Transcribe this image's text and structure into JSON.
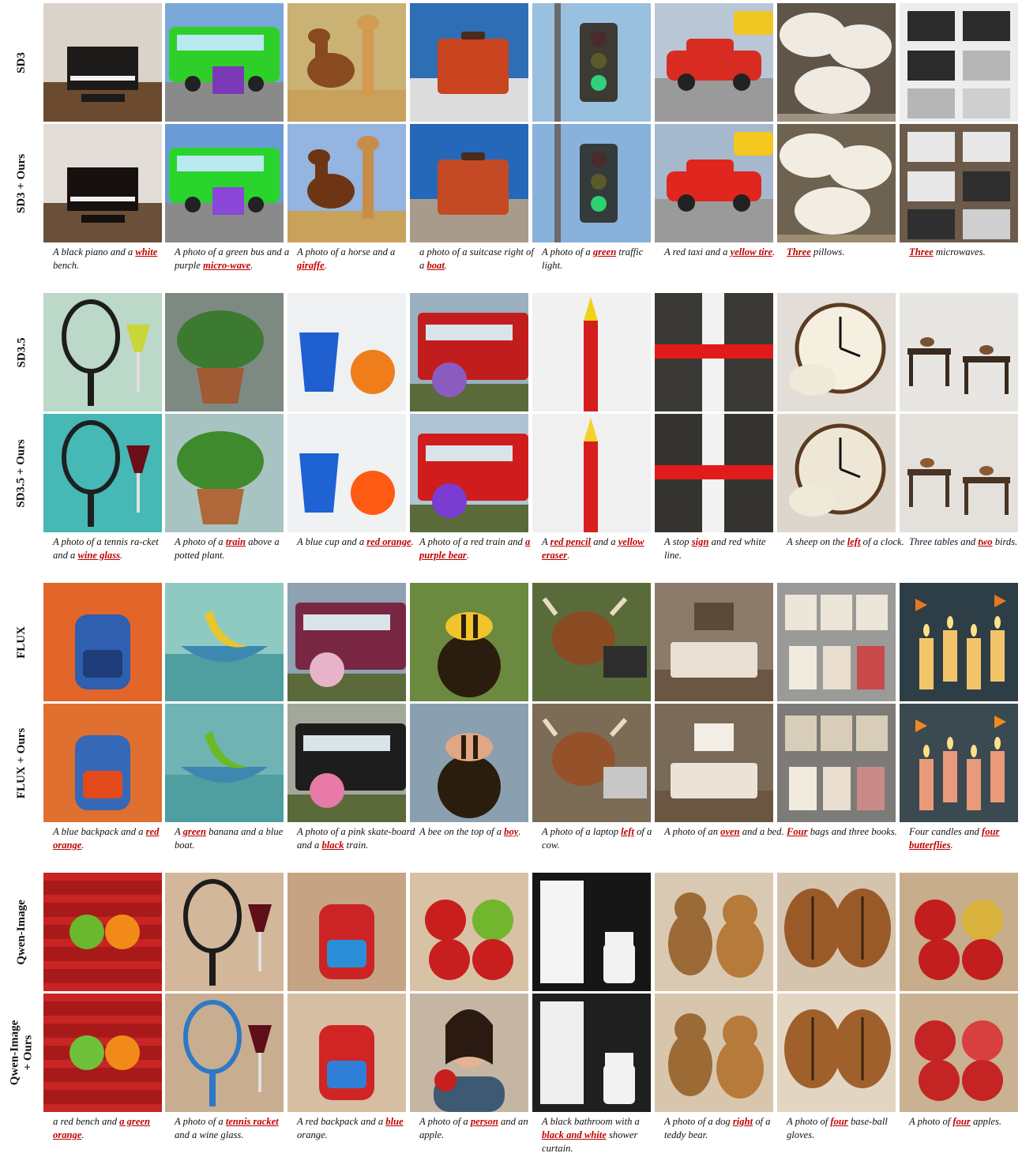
{
  "groups": [
    {
      "rows": [
        "SD3",
        "SD3 + Ours"
      ],
      "tiles": [
        [
          {
            "name": "piano-image",
            "bg": "#d9d3c9",
            "fg": "#1c1b1a",
            "accent": "#6b4a2f",
            "shape": "piano"
          },
          {
            "name": "piano-image",
            "bg": "#e2ddd6",
            "fg": "#16110e",
            "accent": "#6a4f39",
            "shape": "piano"
          }
        ],
        [
          {
            "name": "bus-image",
            "bg": "#7aa8d8",
            "fg": "#2fcf2a",
            "accent": "#7b39b8",
            "shape": "bus"
          },
          {
            "name": "bus-image",
            "bg": "#6b9bd6",
            "fg": "#29d42c",
            "accent": "#8a47d8",
            "shape": "bus"
          }
        ],
        [
          {
            "name": "horse-giraffe-image",
            "bg": "#c9b274",
            "fg": "#8a4a1f",
            "accent": "#d49a52",
            "shape": "animal"
          },
          {
            "name": "horse-giraffe-image",
            "bg": "#93b5df",
            "fg": "#6e3514",
            "accent": "#c98d4a",
            "shape": "animal"
          }
        ],
        [
          {
            "name": "suitcase-image",
            "bg": "#2d6eb5",
            "fg": "#c9441f",
            "accent": "#dcdcdc",
            "shape": "box"
          },
          {
            "name": "suitcase-image",
            "bg": "#2568b9",
            "fg": "#c34a25",
            "accent": "#a99b8c",
            "shape": "box"
          }
        ],
        [
          {
            "name": "traffic-light-image",
            "bg": "#9ac0e0",
            "fg": "#3d3a33",
            "accent": "#2fd17f",
            "shape": "light"
          },
          {
            "name": "traffic-light-image",
            "bg": "#88b2db",
            "fg": "#353a3a",
            "accent": "#2fd06e",
            "shape": "light"
          }
        ],
        [
          {
            "name": "taxi-image",
            "bg": "#b9c6d5",
            "fg": "#d82c23",
            "accent": "#f0c622",
            "shape": "car"
          },
          {
            "name": "taxi-image",
            "bg": "#a6b8cc",
            "fg": "#e0271f",
            "accent": "#f4c81e",
            "shape": "car"
          }
        ],
        [
          {
            "name": "pillows-image",
            "bg": "#5f5548",
            "fg": "#efebe2",
            "accent": "#9d927f",
            "shape": "pillows"
          },
          {
            "name": "pillows-image",
            "bg": "#6e6250",
            "fg": "#f2ede3",
            "accent": "#9b8c72",
            "shape": "pillows"
          }
        ],
        [
          {
            "name": "microwaves-image",
            "bg": "#ededed",
            "fg": "#2b2b2b",
            "accent": "#b6b6b6",
            "shape": "microwaves"
          },
          {
            "name": "microwaves-image",
            "bg": "#6c5b4b",
            "fg": "#e8e8e8",
            "accent": "#2f2f2f",
            "shape": "microwaves"
          }
        ]
      ],
      "captions": [
        [
          {
            "t": "A black piano and a "
          },
          {
            "t": "white",
            "h": true
          },
          {
            "t": " bench."
          }
        ],
        [
          {
            "t": "A photo of a green bus and a purple "
          },
          {
            "t": "micro-wave",
            "h": true
          },
          {
            "t": "."
          }
        ],
        [
          {
            "t": "A photo of a horse and a "
          },
          {
            "t": "giraffe",
            "h": true
          },
          {
            "t": "."
          }
        ],
        [
          {
            "t": "a photo of a suitcase right of a "
          },
          {
            "t": "boat",
            "h": true
          },
          {
            "t": "."
          }
        ],
        [
          {
            "t": "A photo of a "
          },
          {
            "t": "green",
            "h": true
          },
          {
            "t": " traffic light."
          }
        ],
        [
          {
            "t": "A red taxi and a "
          },
          {
            "t": "yellow tire",
            "h": true
          },
          {
            "t": "."
          }
        ],
        [
          {
            "t": "Three",
            "h": true
          },
          {
            "t": " pillows."
          }
        ],
        [
          {
            "t": "Three",
            "h": true
          },
          {
            "t": " microwaves."
          }
        ]
      ]
    },
    {
      "rows": [
        "SD3.5",
        "SD3.5 + Ours"
      ],
      "tiles": [
        [
          {
            "name": "tennis-racket-image",
            "bg": "#bcd8c8",
            "fg": "#1d1d1d",
            "accent": "#c9d63a",
            "shape": "racket"
          },
          {
            "name": "tennis-racket-image",
            "bg": "#46b8b6",
            "fg": "#1f1f1f",
            "accent": "#6a0e1a",
            "shape": "racket"
          }
        ],
        [
          {
            "name": "potted-plant-image",
            "bg": "#7d8a82",
            "fg": "#3d7a31",
            "accent": "#a05a34",
            "shape": "plant"
          },
          {
            "name": "potted-plant-image",
            "bg": "#a8c4c2",
            "fg": "#3f8a2c",
            "accent": "#b0683a",
            "shape": "plant"
          }
        ],
        [
          {
            "name": "cup-orange-image",
            "bg": "#eef0f2",
            "fg": "#1f5fd0",
            "accent": "#ef7d1a",
            "shape": "cup"
          },
          {
            "name": "cup-orange-image",
            "bg": "#f0f1f3",
            "fg": "#1e62d4",
            "accent": "#ff5a12",
            "shape": "cup"
          }
        ],
        [
          {
            "name": "train-bear-image",
            "bg": "#9ab0c0",
            "fg": "#c21d1d",
            "accent": "#8a5cc0",
            "shape": "train"
          },
          {
            "name": "train-bear-image",
            "bg": "#aec4d4",
            "fg": "#d01c1c",
            "accent": "#7a3cd1",
            "shape": "train"
          }
        ],
        [
          {
            "name": "pencil-image",
            "bg": "#f1f1f1",
            "fg": "#d61d1d",
            "accent": "#f0d21a",
            "shape": "pencil"
          },
          {
            "name": "pencil-image",
            "bg": "#f0f0f0",
            "fg": "#d81e1e",
            "accent": "#f2d32c",
            "shape": "pencil"
          }
        ],
        [
          {
            "name": "road-line-image",
            "bg": "#3b3935",
            "fg": "#f2f2f2",
            "accent": "#e11a1a",
            "shape": "road"
          },
          {
            "name": "road-line-image",
            "bg": "#363431",
            "fg": "#f3f3f3",
            "accent": "#e21c1c",
            "shape": "road"
          }
        ],
        [
          {
            "name": "clock-sheep-image",
            "bg": "#e2ddd6",
            "fg": "#f5efe0",
            "accent": "#5b3b22",
            "shape": "clock"
          },
          {
            "name": "clock-sheep-image",
            "bg": "#ddd6cc",
            "fg": "#efe7d6",
            "accent": "#5a3a20",
            "shape": "clock"
          }
        ],
        [
          {
            "name": "tables-birds-image",
            "bg": "#e8e6e3",
            "fg": "#3a2a1e",
            "accent": "#7a5230",
            "shape": "tables"
          },
          {
            "name": "tables-birds-image",
            "bg": "#e4e1dc",
            "fg": "#4a3424",
            "accent": "#8b5c34",
            "shape": "tables"
          }
        ]
      ],
      "captions": [
        [
          {
            "t": "A photo of a tennis ra-cket and a "
          },
          {
            "t": "wine glass",
            "h": true
          },
          {
            "t": "."
          }
        ],
        [
          {
            "t": "A photo of a "
          },
          {
            "t": "train",
            "h": true
          },
          {
            "t": " above a potted plant."
          }
        ],
        [
          {
            "t": "A blue cup and a "
          },
          {
            "t": "red orange",
            "h": true
          },
          {
            "t": "."
          }
        ],
        [
          {
            "t": "A photo of a red train and "
          },
          {
            "t": "a purple bear",
            "h": true
          },
          {
            "t": "."
          }
        ],
        [
          {
            "t": "A "
          },
          {
            "t": "red pencil",
            "h": true
          },
          {
            "t": " and a "
          },
          {
            "t": "yellow eraser",
            "h": true
          },
          {
            "t": "."
          }
        ],
        [
          {
            "t": "A stop "
          },
          {
            "t": "sign",
            "h": true
          },
          {
            "t": " and red white line."
          }
        ],
        [
          {
            "t": "A sheep on the "
          },
          {
            "t": "left",
            "h": true
          },
          {
            "t": " of a clock."
          }
        ],
        [
          {
            "t": "Three tables and "
          },
          {
            "t": "two",
            "h": true
          },
          {
            "t": " birds."
          }
        ]
      ]
    },
    {
      "rows": [
        "FLUX",
        "FLUX + Ours"
      ],
      "tiles": [
        [
          {
            "name": "backpack-image",
            "bg": "#e2652a",
            "fg": "#2f5fae",
            "accent": "#1d3c78",
            "shape": "backpack"
          },
          {
            "name": "backpack-image",
            "bg": "#e0702f",
            "fg": "#3668b8",
            "accent": "#e24a1c",
            "shape": "backpack"
          }
        ],
        [
          {
            "name": "banana-boat-image",
            "bg": "#8fcac2",
            "fg": "#e9c62c",
            "accent": "#4fa0a8",
            "shape": "banana"
          },
          {
            "name": "banana-boat-image",
            "bg": "#6fb3b3",
            "fg": "#6cb828",
            "accent": "#3c8fa3",
            "shape": "banana"
          }
        ],
        [
          {
            "name": "train-skateboard-image",
            "bg": "#8ea2b3",
            "fg": "#7a2743",
            "accent": "#e6b3c8",
            "shape": "train"
          },
          {
            "name": "train-skateboard-image",
            "bg": "#a4a89b",
            "fg": "#1d1d1d",
            "accent": "#e87aa8",
            "shape": "train"
          }
        ],
        [
          {
            "name": "bee-image",
            "bg": "#6b8a3f",
            "fg": "#f0c42a",
            "accent": "#2b1d0e",
            "shape": "bee"
          },
          {
            "name": "bee-image",
            "bg": "#8aa0b0",
            "fg": "#e0a783",
            "accent": "#2b1d0e",
            "shape": "bee"
          }
        ],
        [
          {
            "name": "cow-laptop-image",
            "bg": "#5a6b3a",
            "fg": "#8a4a22",
            "accent": "#2d2d2d",
            "shape": "cow"
          },
          {
            "name": "cow-laptop-image",
            "bg": "#7c6b55",
            "fg": "#94512a",
            "accent": "#c7c7c7",
            "shape": "cow"
          }
        ],
        [
          {
            "name": "bedroom-image",
            "bg": "#8c7b68",
            "fg": "#e9e0d3",
            "accent": "#5b4a3a",
            "shape": "bed"
          },
          {
            "name": "bedroom-image",
            "bg": "#7a6a58",
            "fg": "#ece3d6",
            "accent": "#f2ede5",
            "shape": "bed"
          }
        ],
        [
          {
            "name": "bags-books-image",
            "bg": "#9a9a98",
            "fg": "#ece6d8",
            "accent": "#c84a4a",
            "shape": "bags"
          },
          {
            "name": "bags-books-image",
            "bg": "#7d7b78",
            "fg": "#d8cdb8",
            "accent": "#c98a8a",
            "shape": "bags"
          }
        ],
        [
          {
            "name": "candles-butterflies-image",
            "bg": "#2e3e46",
            "fg": "#f3c56a",
            "accent": "#e5781f",
            "shape": "candles"
          },
          {
            "name": "candles-butterflies-image",
            "bg": "#3a4a50",
            "fg": "#e89a7a",
            "accent": "#ee8a1f",
            "shape": "candles"
          }
        ]
      ],
      "captions": [
        [
          {
            "t": "A blue backpack and a "
          },
          {
            "t": "red orange",
            "h": true
          },
          {
            "t": "."
          }
        ],
        [
          {
            "t": "A "
          },
          {
            "t": "green",
            "h": true
          },
          {
            "t": " banana and a blue boat."
          }
        ],
        [
          {
            "t": "A photo of a pink skate-board and a "
          },
          {
            "t": "black",
            "h": true
          },
          {
            "t": " train."
          }
        ],
        [
          {
            "t": "A bee on the top of a "
          },
          {
            "t": "boy",
            "h": true
          },
          {
            "t": "."
          }
        ],
        [
          {
            "t": "A photo of a laptop "
          },
          {
            "t": "left",
            "h": true
          },
          {
            "t": " of a cow."
          }
        ],
        [
          {
            "t": "A photo of an "
          },
          {
            "t": "oven",
            "h": true
          },
          {
            "t": " and a bed."
          }
        ],
        [
          {
            "t": "Four",
            "h": true
          },
          {
            "t": " bags and three books."
          }
        ],
        [
          {
            "t": "Four candles and "
          },
          {
            "t": "four butterflies",
            "h": true
          },
          {
            "t": "."
          }
        ]
      ]
    },
    {
      "rows": [
        "Qwen-Image",
        "Qwen-Image\n+ Ours"
      ],
      "tiles": [
        [
          {
            "name": "bench-fruit-image",
            "bg": "#c92323",
            "fg": "#6ab82d",
            "accent": "#f28a1a",
            "shape": "bench"
          },
          {
            "name": "bench-fruit-image",
            "bg": "#c82525",
            "fg": "#6fc03a",
            "accent": "#f28a1a",
            "shape": "bench"
          }
        ],
        [
          {
            "name": "racket-wine-image",
            "bg": "#d2b79a",
            "fg": "#1c1c1c",
            "accent": "#5e0f19",
            "shape": "racket"
          },
          {
            "name": "racket-wine-image",
            "bg": "#c9ad90",
            "fg": "#2e78c7",
            "accent": "#5e0f19",
            "shape": "racket"
          }
        ],
        [
          {
            "name": "backpack-image",
            "bg": "#c6a483",
            "fg": "#cc2424",
            "accent": "#2a8fd6",
            "shape": "backpack"
          },
          {
            "name": "backpack-image",
            "bg": "#d6bea3",
            "fg": "#d12424",
            "accent": "#2f7fd8",
            "shape": "backpack"
          }
        ],
        [
          {
            "name": "apples-image",
            "bg": "#d8c2a5",
            "fg": "#c81e1e",
            "accent": "#72b62d",
            "shape": "apples"
          },
          {
            "name": "person-apple-image",
            "bg": "#c5b6a4",
            "fg": "#3d5a72",
            "accent": "#c81e1e",
            "shape": "person"
          }
        ],
        [
          {
            "name": "bathroom-image",
            "bg": "#161616",
            "fg": "#f4f4f4",
            "accent": "#3a3a3a",
            "shape": "bath"
          },
          {
            "name": "bathroom-image",
            "bg": "#1f1f1f",
            "fg": "#efefef",
            "accent": "#4a4a4a",
            "shape": "bath"
          }
        ],
        [
          {
            "name": "dog-bear-image",
            "bg": "#d9c9b2",
            "fg": "#9b6a36",
            "accent": "#6b4020",
            "shape": "dog"
          },
          {
            "name": "dog-bear-image",
            "bg": "#d7c6ac",
            "fg": "#9c6a35",
            "accent": "#3a2414",
            "shape": "dog"
          }
        ],
        [
          {
            "name": "baseball-gloves-image",
            "bg": "#d4c4ad",
            "fg": "#9a5a28",
            "accent": "#3a2414",
            "shape": "gloves"
          },
          {
            "name": "baseball-gloves-image",
            "bg": "#e2d6c3",
            "fg": "#a0602c",
            "accent": "#3a2414",
            "shape": "gloves"
          }
        ],
        [
          {
            "name": "apples-image",
            "bg": "#c7ad8c",
            "fg": "#c21e1e",
            "accent": "#d8b23a",
            "shape": "apples"
          },
          {
            "name": "apples-image",
            "bg": "#c9b192",
            "fg": "#c42424",
            "accent": "#d84040",
            "shape": "apples"
          }
        ]
      ],
      "captions": [
        [
          {
            "t": "a red bench and "
          },
          {
            "t": "a green orange",
            "h": true
          },
          {
            "t": "."
          }
        ],
        [
          {
            "t": "A photo of a "
          },
          {
            "t": "tennis racket",
            "h": true
          },
          {
            "t": " and a wine glass."
          }
        ],
        [
          {
            "t": "A red backpack and a "
          },
          {
            "t": "blue",
            "h": true
          },
          {
            "t": " orange."
          }
        ],
        [
          {
            "t": "A photo of a "
          },
          {
            "t": "person",
            "h": true
          },
          {
            "t": " and an apple."
          }
        ],
        [
          {
            "t": "A black bathroom with a "
          },
          {
            "t": "black and white",
            "h": true
          },
          {
            "t": " shower curtain."
          }
        ],
        [
          {
            "t": "A photo of a dog "
          },
          {
            "t": "right",
            "h": true
          },
          {
            "t": " of a teddy bear."
          }
        ],
        [
          {
            "t": "A photo of "
          },
          {
            "t": "four",
            "h": true
          },
          {
            "t": " base-ball gloves."
          }
        ],
        [
          {
            "t": "A photo of "
          },
          {
            "t": "four",
            "h": true
          },
          {
            "t": " apples."
          }
        ]
      ]
    }
  ]
}
